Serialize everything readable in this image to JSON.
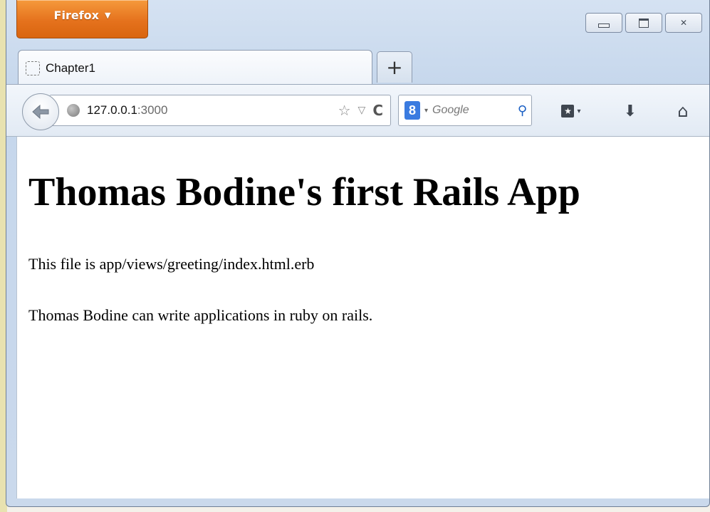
{
  "browser": {
    "menu_button_label": "Firefox",
    "menu_button_caret": "▼",
    "caption_buttons": {
      "minimize": "minimize",
      "maximize": "maximize",
      "close_glyph": "✕"
    },
    "tab": {
      "title": "Chapter1",
      "icon": "blank-page-icon"
    },
    "new_tab_label": "+",
    "url": {
      "host": "127.0.0.1",
      "port": ":3000",
      "bookmark_glyph": "☆",
      "dropdown_glyph": "▽",
      "reload_glyph": "C"
    },
    "search": {
      "engine_glyph": "8",
      "dropdown_glyph": "▾",
      "placeholder": "Google",
      "search_glyph": "⚲"
    },
    "toolbar_icons": {
      "bookmarks_glyph": "★",
      "bookmarks_dropdown": "▾",
      "downloads_glyph": "⬇",
      "home_glyph": "⌂"
    },
    "colors": {
      "firefox_button": "#e5721d",
      "chrome": "#d5e2f2"
    }
  },
  "page": {
    "title": "Thomas Bodine's first Rails App",
    "paragraphs": [
      "This file is app/views/greeting/index.html.erb",
      "Thomas Bodine can write applications in ruby on rails."
    ]
  }
}
